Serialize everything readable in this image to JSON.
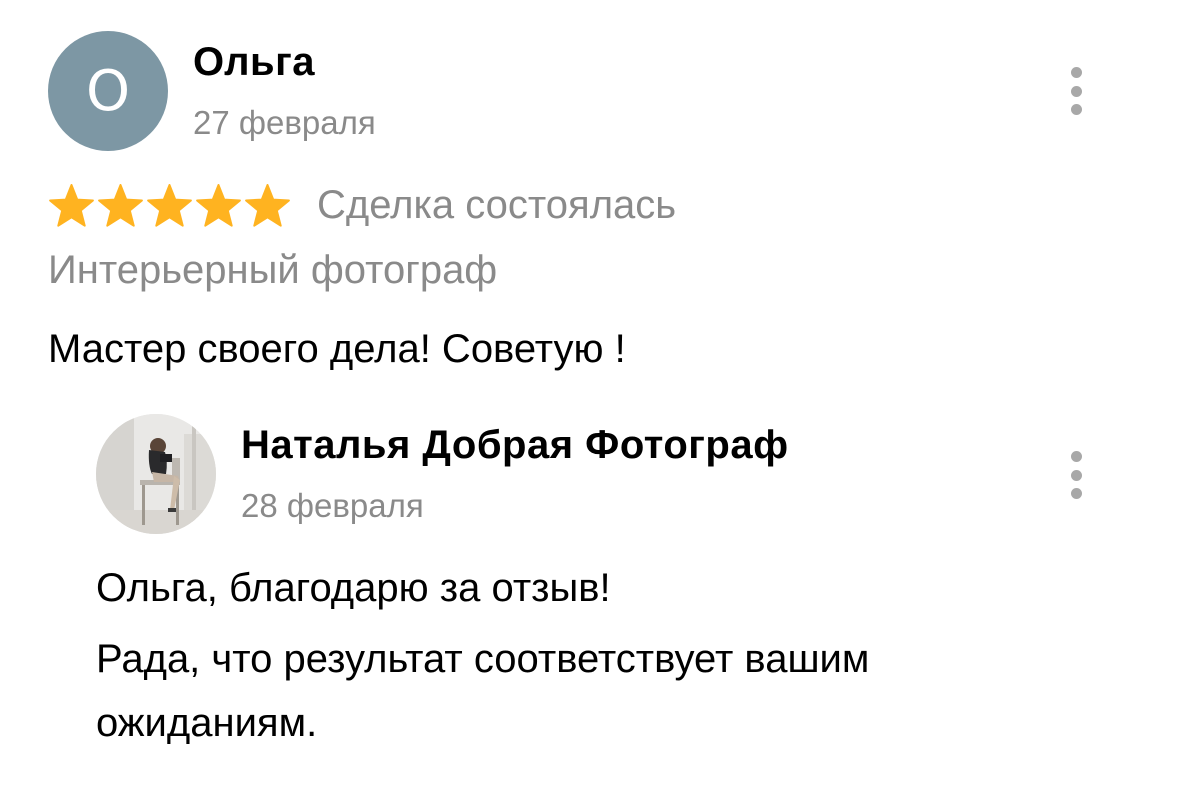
{
  "review": {
    "avatar_letter": "О",
    "avatar_color": "#7d97a4",
    "author": "Ольга",
    "date": "27 февраля",
    "rating": 5,
    "rating_max": 5,
    "star_color": "#ffb320",
    "deal_status": "Сделка состоялась",
    "service": "Интерьерный фотограф",
    "text": "Мастер своего дела! Советую !",
    "menu_icon": "more-vertical-icon"
  },
  "reply": {
    "avatar_icon": "user-photo-avatar",
    "author": "Наталья Добрая Фотограф",
    "date": "28 февраля",
    "text_lines": [
      "Ольга, благодарю за отзыв!",
      "Рада, что результат соответствует вашим",
      "ожиданиям."
    ],
    "menu_icon": "more-vertical-icon"
  }
}
